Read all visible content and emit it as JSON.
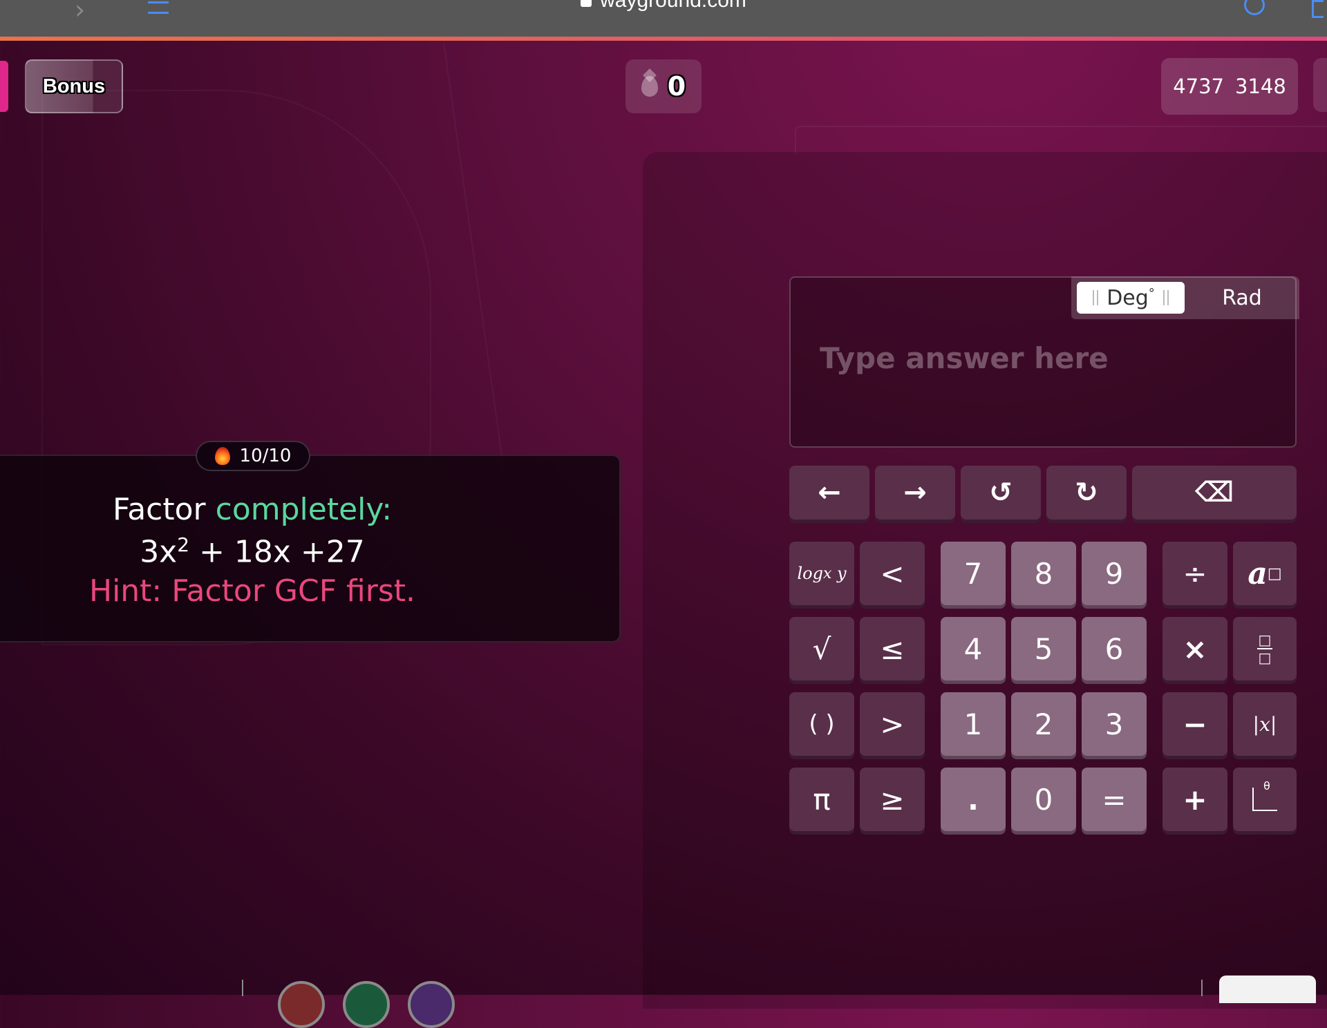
{
  "browser": {
    "url": "wayground.com"
  },
  "topbar": {
    "bonus_label": "Bonus",
    "streak_value": "0",
    "score_a": "4737",
    "score_b": "3148"
  },
  "question": {
    "progress": "10/10",
    "line1_word": "Factor",
    "line1_accent": "completely:",
    "line2_prefix": "3x",
    "line2_exp": "2",
    "line2_rest": "+ 18x +27",
    "hint": "Hint: Factor GCF first."
  },
  "answer": {
    "placeholder": "Type answer here",
    "mode_deg": "Deg",
    "mode_deg_mark": "°",
    "mode_rad": "Rad"
  },
  "keypad": {
    "nav": {
      "left": "←",
      "right": "→",
      "undo": "↺",
      "redo": "↻",
      "backspace": "⌫"
    },
    "func": {
      "log": "log",
      "log_sub": "x",
      "log_arg": "y",
      "sqrt": "√",
      "parens": "( )",
      "pi": "π",
      "lt": "<",
      "le": "≤",
      "gt": ">",
      "ge": "≥"
    },
    "digits": {
      "d7": "7",
      "d8": "8",
      "d9": "9",
      "d4": "4",
      "d5": "5",
      "d6": "6",
      "d1": "1",
      "d2": "2",
      "d3": "3",
      "dot": ".",
      "d0": "0",
      "eq": "="
    },
    "ops": {
      "div": "÷",
      "mul": "×",
      "minus": "−",
      "plus": "+"
    },
    "templates": {
      "power": "a",
      "power_box": "□",
      "fraction_box": "□",
      "abs": "|x|",
      "graph_theta": "θ"
    }
  },
  "colors": {
    "accent_green": "#5ad89e",
    "hint_pink": "#e9487d",
    "bonus_pink": "#e0288a"
  },
  "icons": [
    "lock-icon",
    "chevron-right-icon",
    "list-icon",
    "reload-icon",
    "drop-icon",
    "fire-icon",
    "arrow-left-icon",
    "arrow-right-icon",
    "undo-icon",
    "redo-icon",
    "backspace-icon"
  ]
}
